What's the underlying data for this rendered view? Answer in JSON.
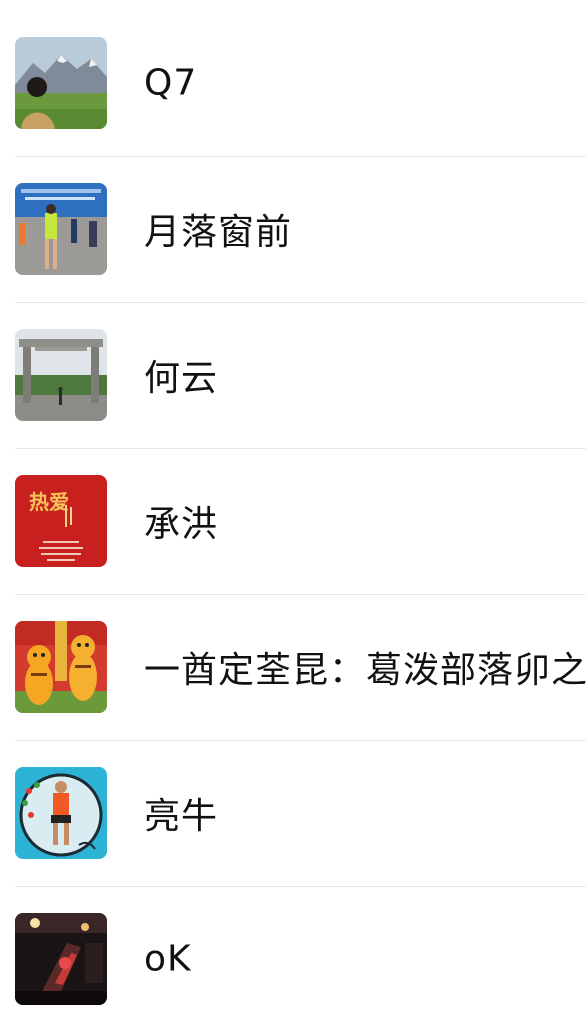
{
  "contacts": [
    {
      "name": "Q7",
      "avatar": "avatar-mountain-person"
    },
    {
      "name": "月落窗前",
      "avatar": "avatar-runner-event"
    },
    {
      "name": "何云",
      "avatar": "avatar-stone-gate"
    },
    {
      "name": "承洪",
      "avatar": "avatar-red-poster"
    },
    {
      "name": "一酋定荃昆：葛泼部落卯之",
      "avatar": "avatar-tiger-mascots"
    },
    {
      "name": "亮牛",
      "avatar": "avatar-marathon-runner"
    },
    {
      "name": "oK",
      "avatar": "avatar-night-scene"
    }
  ],
  "avatar_text": {
    "red_poster_title": "热爱"
  }
}
